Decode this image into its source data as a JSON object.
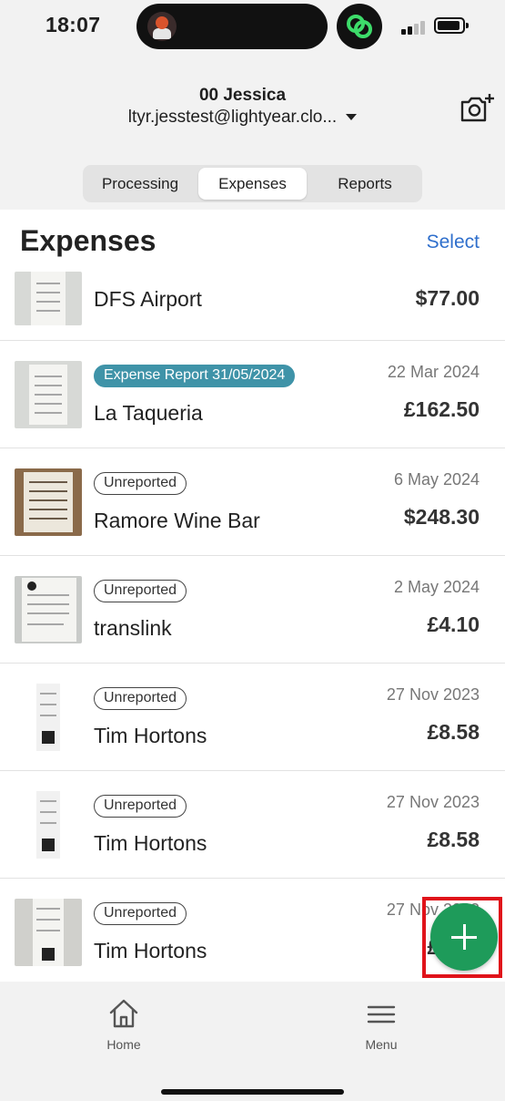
{
  "status_bar": {
    "time": "18:07",
    "icons": [
      "avatar-icon",
      "linkage-app-icon",
      "signal-icon",
      "battery-icon"
    ]
  },
  "header": {
    "user_name": "00 Jessica",
    "user_email": "ltyr.jesstest@lightyear.clo...",
    "camera_icon": "add-photo-camera-icon"
  },
  "tabs": {
    "items": [
      {
        "label": "Processing",
        "active": false
      },
      {
        "label": "Expenses",
        "active": true
      },
      {
        "label": "Reports",
        "active": false
      }
    ]
  },
  "page": {
    "title": "Expenses",
    "select_label": "Select"
  },
  "expenses": [
    {
      "badge": "",
      "merchant": "DFS Airport",
      "date": "",
      "amount": "$77.00"
    },
    {
      "badge": "Expense Report 31/05/2024",
      "merchant": "La Taqueria",
      "date": "22 Mar 2024",
      "amount": "£162.50"
    },
    {
      "badge": "Unreported",
      "merchant": "Ramore Wine Bar",
      "date": "6 May 2024",
      "amount": "$248.30"
    },
    {
      "badge": "Unreported",
      "merchant": "translink",
      "date": "2 May 2024",
      "amount": "£4.10"
    },
    {
      "badge": "Unreported",
      "merchant": "Tim Hortons",
      "date": "27 Nov 2023",
      "amount": "£8.58"
    },
    {
      "badge": "Unreported",
      "merchant": "Tim Hortons",
      "date": "27 Nov 2023",
      "amount": "£8.58"
    },
    {
      "badge": "Unreported",
      "merchant": "Tim Hortons",
      "date": "27 Nov 2023",
      "amount": "£8.58"
    }
  ],
  "fab": {
    "icon": "plus-icon",
    "highlight_color": "#e0131a",
    "color": "#1e9b5a"
  },
  "bottom_nav": {
    "items": [
      {
        "label": "Home",
        "icon": "home-icon"
      },
      {
        "label": "Menu",
        "icon": "hamburger-menu-icon"
      }
    ]
  },
  "colors": {
    "accent": "#2f6fcc",
    "report_badge": "#3f93a8"
  }
}
